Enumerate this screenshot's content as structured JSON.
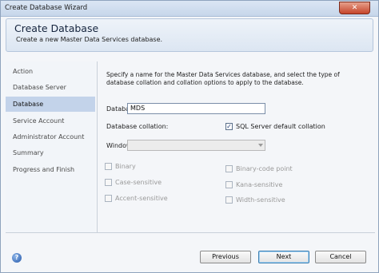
{
  "window": {
    "title": "Create Database Wizard",
    "close_glyph": "✕"
  },
  "header": {
    "title": "Create Database",
    "subtitle": "Create a new Master Data Services database."
  },
  "nav": {
    "items": [
      {
        "label": "Action"
      },
      {
        "label": "Database Server"
      },
      {
        "label": "Database",
        "selected": true
      },
      {
        "label": "Service Account"
      },
      {
        "label": "Administrator Account"
      },
      {
        "label": "Summary"
      },
      {
        "label": "Progress and Finish"
      }
    ]
  },
  "content": {
    "description": "Specify a name for the Master Data Services database, and select the type of database collation and collation options to apply to the database.",
    "database_name_label": "Database name:",
    "database_name_value": "MDS",
    "database_collation_label": "Database collation:",
    "sql_default_collation_label": "SQL Server default collation",
    "sql_default_collation_checked": true,
    "windows_collation_label": "Windows collation:",
    "windows_collation_value": "",
    "options_left": [
      {
        "label": "Binary",
        "checked": false
      },
      {
        "label": "Case-sensitive",
        "checked": false
      },
      {
        "label": "Accent-sensitive",
        "checked": false
      }
    ],
    "options_right": [
      {
        "label": "Binary-code point",
        "checked": false
      },
      {
        "label": "Kana-sensitive",
        "checked": false
      },
      {
        "label": "Width-sensitive",
        "checked": false
      }
    ]
  },
  "footer": {
    "help_glyph": "?",
    "previous_label": "Previous",
    "next_label": "Next",
    "cancel_label": "Cancel"
  },
  "colors": {
    "accent": "#c3d3ea",
    "header_bg": "#dce6f2",
    "close_button": "#c6452b"
  }
}
